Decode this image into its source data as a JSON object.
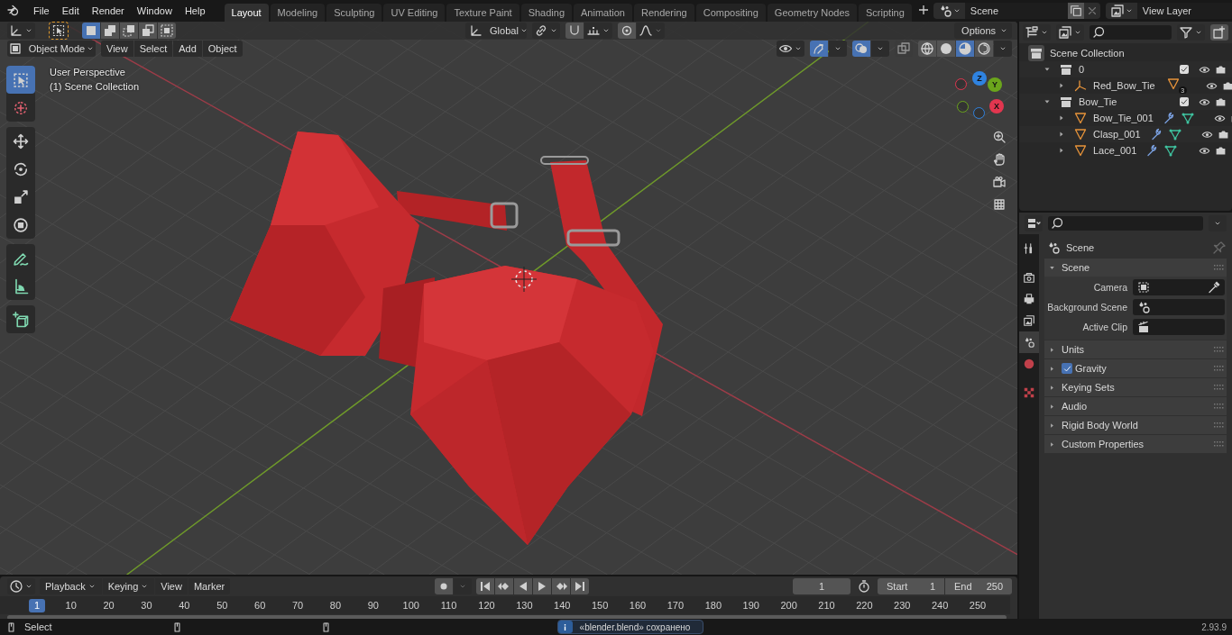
{
  "menubar": {
    "menus": [
      "File",
      "Edit",
      "Render",
      "Window",
      "Help"
    ]
  },
  "workspaces": [
    {
      "label": "Layout",
      "selected": true
    },
    {
      "label": "Modeling",
      "selected": false
    },
    {
      "label": "Sculpting",
      "selected": false
    },
    {
      "label": "UV Editing",
      "selected": false
    },
    {
      "label": "Texture Paint",
      "selected": false
    },
    {
      "label": "Shading",
      "selected": false
    },
    {
      "label": "Animation",
      "selected": false
    },
    {
      "label": "Rendering",
      "selected": false
    },
    {
      "label": "Compositing",
      "selected": false
    },
    {
      "label": "Geometry Nodes",
      "selected": false
    },
    {
      "label": "Scripting",
      "selected": false
    }
  ],
  "scene_selector": {
    "value": "Scene"
  },
  "view_layer_selector": {
    "value": "View Layer"
  },
  "tool_header": {
    "orientation": "Global",
    "options": "Options",
    "select_modes": [
      {
        "selected": true
      },
      {
        "selected": false
      },
      {
        "selected": false
      },
      {
        "selected": false
      },
      {
        "selected": false
      }
    ]
  },
  "viewport_header": {
    "mode": "Object Mode",
    "menus": [
      "View",
      "Select",
      "Add",
      "Object"
    ],
    "shading": [
      {
        "selected": false
      },
      {
        "selected": false
      },
      {
        "selected": true
      },
      {
        "selected": false
      }
    ]
  },
  "viewport": {
    "overlay_lines": [
      "User Perspective",
      "(1) Scene Collection"
    ],
    "gizmo_axes": [
      {
        "label": "Z",
        "color": "#2f83e0"
      },
      {
        "label": "Y",
        "color": "#6ba51c"
      },
      {
        "label": "X",
        "color": "#e2364f"
      }
    ]
  },
  "tools": [
    {
      "kind": "select",
      "selected": true
    },
    {
      "kind": "cursor",
      "selected": false
    },
    {
      "kind": "move",
      "selected": false
    },
    {
      "kind": "rotate",
      "selected": false
    },
    {
      "kind": "scale",
      "selected": false
    },
    {
      "kind": "transform",
      "selected": false
    },
    {
      "kind": "annotate",
      "selected": false
    },
    {
      "kind": "measure",
      "selected": false
    },
    {
      "kind": "add_cube",
      "selected": false
    }
  ],
  "timeline": {
    "menus": [
      "Playback",
      "Keying",
      "View",
      "Marker"
    ],
    "current_frame": "1",
    "start_label": "Start",
    "start": "1",
    "end_label": "End",
    "end": "250",
    "ruler": [
      {
        "label": "1",
        "selected": true
      },
      {
        "label": "10",
        "selected": false
      },
      {
        "label": "20",
        "selected": false
      },
      {
        "label": "30",
        "selected": false
      },
      {
        "label": "40",
        "selected": false
      },
      {
        "label": "50",
        "selected": false
      },
      {
        "label": "60",
        "selected": false
      },
      {
        "label": "70",
        "selected": false
      },
      {
        "label": "80",
        "selected": false
      },
      {
        "label": "90",
        "selected": false
      },
      {
        "label": "100",
        "selected": false
      },
      {
        "label": "110",
        "selected": false
      },
      {
        "label": "120",
        "selected": false
      },
      {
        "label": "130",
        "selected": false
      },
      {
        "label": "140",
        "selected": false
      },
      {
        "label": "150",
        "selected": false
      },
      {
        "label": "160",
        "selected": false
      },
      {
        "label": "170",
        "selected": false
      },
      {
        "label": "180",
        "selected": false
      },
      {
        "label": "190",
        "selected": false
      },
      {
        "label": "200",
        "selected": false
      },
      {
        "label": "210",
        "selected": false
      },
      {
        "label": "220",
        "selected": false
      },
      {
        "label": "230",
        "selected": false
      },
      {
        "label": "240",
        "selected": false
      },
      {
        "label": "250",
        "selected": false
      }
    ]
  },
  "status_bar": {
    "action": "Select",
    "message": "«blender.blend» сохранено",
    "version": "2.93.9"
  },
  "outliner": {
    "items": [
      {
        "label": "Scene Collection",
        "kind": "scene_collection",
        "children": [
          {
            "label": "0",
            "kind": "collection",
            "expanded": true,
            "checked": true,
            "children": [
              {
                "label": "Red_Bow_Tie",
                "kind": "empty",
                "expanded": false,
                "badge": "3"
              }
            ]
          },
          {
            "label": "Bow_Tie",
            "kind": "collection",
            "expanded": true,
            "checked": true,
            "children": [
              {
                "label": "Bow_Tie_001",
                "kind": "mesh",
                "expanded": false
              },
              {
                "label": "Clasp_001",
                "kind": "mesh",
                "expanded": false
              },
              {
                "label": "Lace_001",
                "kind": "mesh",
                "expanded": false
              }
            ]
          }
        ]
      }
    ]
  },
  "properties": {
    "tabs": [
      {
        "kind": "tool",
        "selected": false
      },
      {
        "kind": "render",
        "selected": false
      },
      {
        "kind": "output",
        "selected": false
      },
      {
        "kind": "view_layer",
        "selected": false
      },
      {
        "kind": "scene",
        "selected": true
      },
      {
        "kind": "world",
        "selected": false
      },
      {
        "kind": "texture",
        "selected": false
      }
    ],
    "context": "Scene",
    "panels": [
      {
        "title": "Scene",
        "kind": "plain",
        "expanded": true,
        "fields": [
          {
            "label": "Camera",
            "kind": "camera"
          },
          {
            "label": "Background Scene",
            "kind": "scene"
          },
          {
            "label": "Active Clip",
            "kind": "clip"
          }
        ]
      },
      {
        "title": "Units",
        "kind": "plain",
        "expanded": false
      },
      {
        "title": "Gravity",
        "kind": "checkbox",
        "expanded": false,
        "checked": true
      },
      {
        "title": "Keying Sets",
        "kind": "plain",
        "expanded": false
      },
      {
        "title": "Audio",
        "kind": "plain",
        "expanded": false
      },
      {
        "title": "Rigid Body World",
        "kind": "plain",
        "expanded": false
      },
      {
        "title": "Custom Properties",
        "kind": "plain",
        "expanded": false
      }
    ]
  }
}
